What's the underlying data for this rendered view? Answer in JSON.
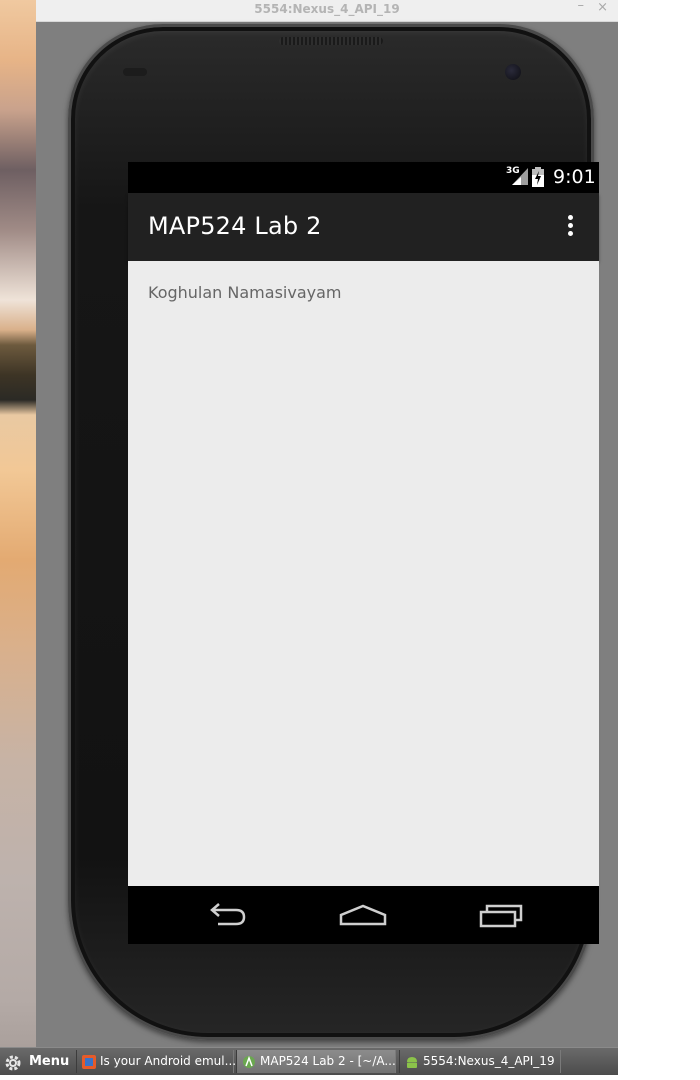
{
  "window": {
    "title": "5554:Nexus_4_API_19",
    "minimize_glyph": "–",
    "close_glyph": "×"
  },
  "statusbar": {
    "network": "3G",
    "time": "9:01"
  },
  "app": {
    "title": "MAP524 Lab 2",
    "text": "Koghulan Namasivayam"
  },
  "icons": {
    "overflow": "overflow-menu-icon",
    "back": "back-icon",
    "home": "home-icon",
    "recent": "recent-apps-icon",
    "signal": "signal-icon",
    "battery": "battery-icon"
  },
  "taskbar": {
    "menu_label": "Menu",
    "tasks": [
      {
        "label": "Is your Android emul..."
      },
      {
        "label": "MAP524 Lab 2 - [~/A..."
      },
      {
        "label": "5554:Nexus_4_API_19"
      }
    ]
  },
  "colors": {
    "action_bar": "#212121",
    "content_bg": "#ececec",
    "text": "#666666"
  }
}
